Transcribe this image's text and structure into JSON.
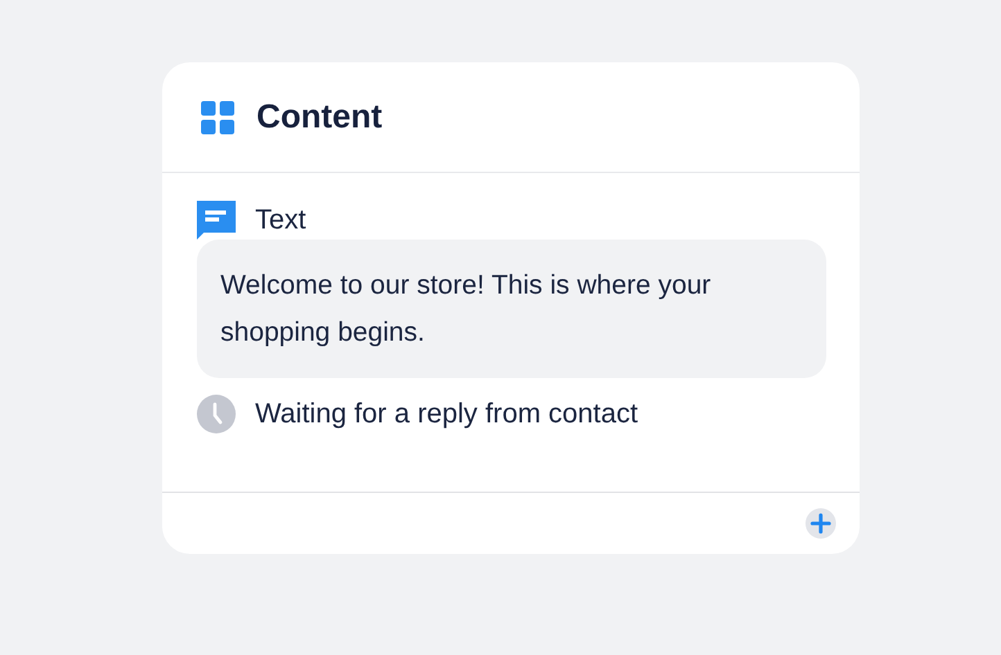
{
  "card": {
    "title": "Content"
  },
  "steps": [
    {
      "kind": "message",
      "label": "Text",
      "message": "Welcome to our store! This is where your shopping begins."
    },
    {
      "kind": "wait",
      "label": "Waiting for a reply from contact"
    }
  ]
}
